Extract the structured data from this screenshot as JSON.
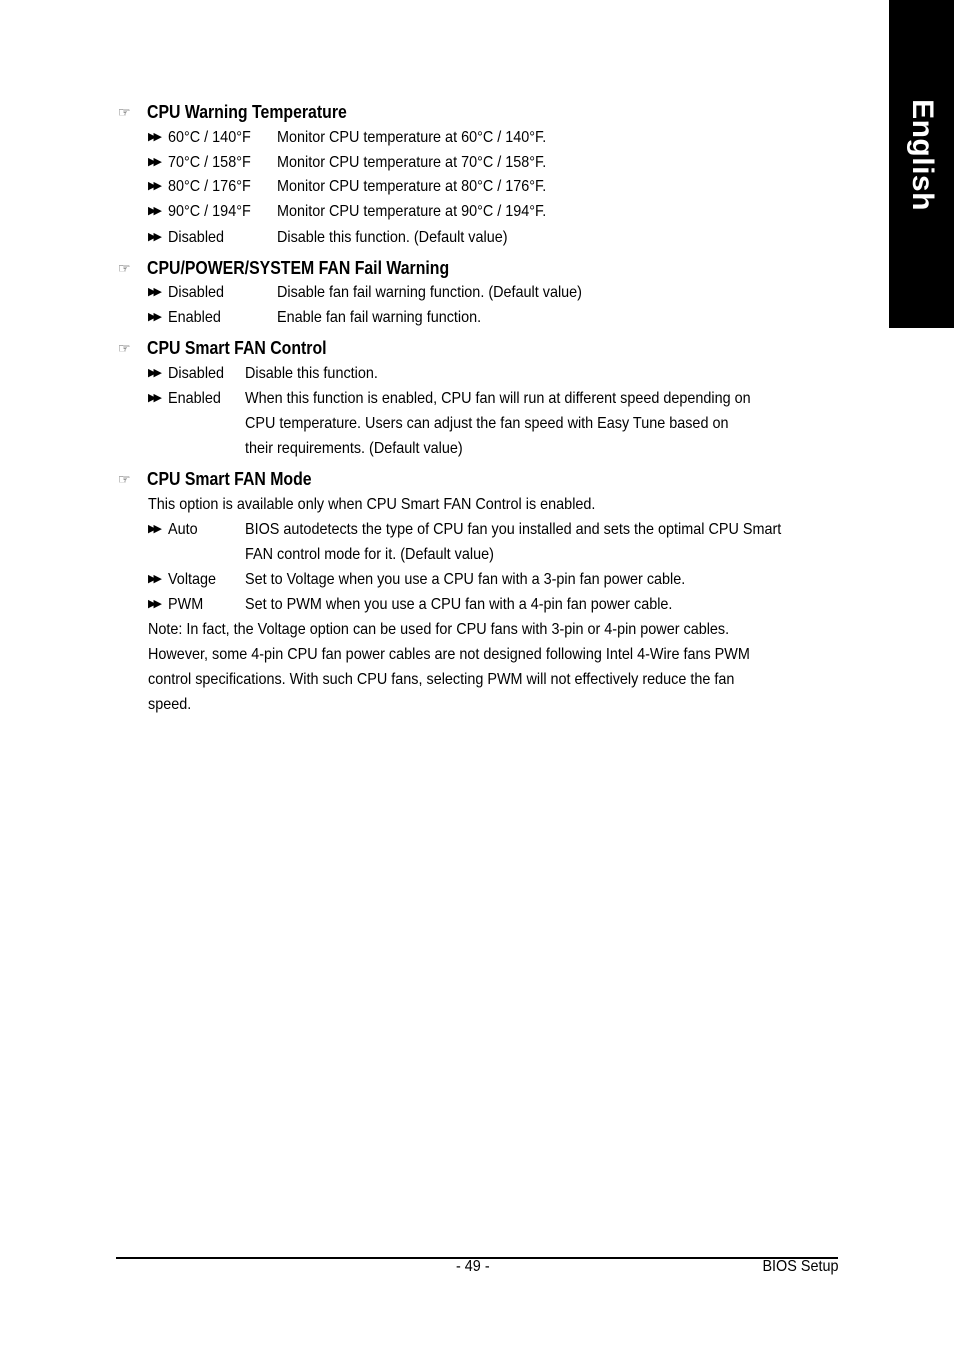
{
  "side_tab": {
    "label": "English"
  },
  "sections": [
    {
      "heading": "CPU Warning Temperature",
      "options": [
        {
          "option": "60°C / 140°F",
          "description": "Monitor CPU temperature at 60°C / 140°F."
        },
        {
          "option": "70°C / 158°F",
          "description": "Monitor CPU temperature at 70°C / 158°F."
        },
        {
          "option": "80°C / 176°F",
          "description": "Monitor CPU temperature at 80°C / 176°F."
        },
        {
          "option": "90°C / 194°F",
          "description": "Monitor CPU temperature at 90°C / 194°F."
        },
        {
          "option": "Disabled",
          "description": "Disable this function. (Default value)"
        }
      ]
    },
    {
      "heading": "CPU/POWER/SYSTEM FAN Fail Warning",
      "options": [
        {
          "option": "Disabled",
          "description": "Disable fan fail warning function. (Default value)"
        },
        {
          "option": "Enabled",
          "description": "Enable fan fail warning function."
        }
      ]
    },
    {
      "heading": "CPU Smart FAN Control",
      "options": [
        {
          "option": "Disabled",
          "description": "Disable this function."
        },
        {
          "option": "Enabled",
          "description": "When this function is enabled, CPU fan will run at different speed depending on",
          "continuation": [
            "CPU temperature. Users can adjust the fan speed with Easy Tune based on",
            "their requirements.  (Default value)"
          ]
        }
      ]
    },
    {
      "heading": "CPU Smart FAN Mode",
      "intro": "This option is available only when CPU Smart FAN Control is enabled.",
      "options": [
        {
          "option": "Auto",
          "description": "BIOS autodetects the type of CPU fan you installed and sets the optimal CPU Smart",
          "continuation": [
            "FAN control mode for it. (Default value)"
          ]
        },
        {
          "option": "Voltage",
          "description": "Set to Voltage when you use a CPU fan with a 3-pin fan power cable."
        },
        {
          "option": "PWM",
          "description": "Set to PWM when you use a CPU fan with a 4-pin fan power cable."
        }
      ],
      "note": [
        "Note: In fact, the Voltage option can be used for CPU fans with 3-pin or 4-pin power cables.",
        "However, some 4-pin CPU fan power cables are not designed following Intel 4-Wire fans PWM",
        "control specifications. With such CPU fans, selecting PWM will not effectively reduce the fan",
        "speed."
      ]
    }
  ],
  "footer": {
    "page_number": "- 49 -",
    "chapter": "BIOS Setup"
  }
}
